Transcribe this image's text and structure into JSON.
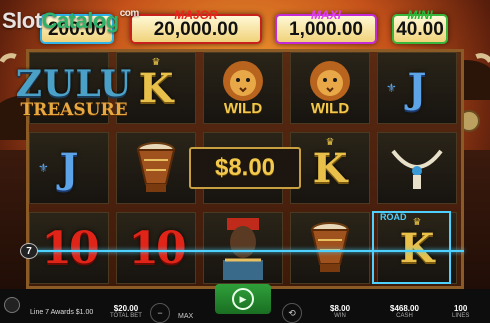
{
  "watermark": {
    "main": "Slot",
    "sub": "com",
    "overlay": "Catalog"
  },
  "jackpots": {
    "grand_value": "200.00",
    "major_label": "MAJOR",
    "major_value": "20,000.00",
    "maxi_label": "MAXI",
    "maxi_value": "1,000.00",
    "mini_label": "MINI",
    "mini_value": "40.00"
  },
  "logo": {
    "title": "ZULU",
    "subtitle": "TREASURE"
  },
  "symbols": {
    "k": "K",
    "j": "J",
    "ten": "10",
    "wild": "WILD",
    "deco_crown": "♛",
    "deco_fleur": "⚜",
    "lion_icon": "lion-icon",
    "drum_icon": "drum-icon",
    "warrior_icon": "warrior-icon",
    "necklace_icon": "necklace-icon"
  },
  "win_amount": "$8.00",
  "payline_number": "7",
  "highlight_tag": "ROAD",
  "sub_logo": "ZULU\nURE",
  "bottom_bar": {
    "status": "Line 7 Awards $1.00",
    "total_bet_value": "$20.00",
    "total_bet_label": "TOTAL BET",
    "max_label": "MAX",
    "win_value": "$8.00",
    "win_label": "WIN",
    "cash_value": "$468.00",
    "cash_label": "CASH",
    "lines_value": "100",
    "lines_label": "LINES"
  },
  "colors": {
    "grand": "#2fb3e8",
    "major": "#c8201a",
    "maxi": "#c22bd6",
    "mini": "#39b53b",
    "win_line": "#4fd1ff",
    "spin": "#2fa03a"
  }
}
